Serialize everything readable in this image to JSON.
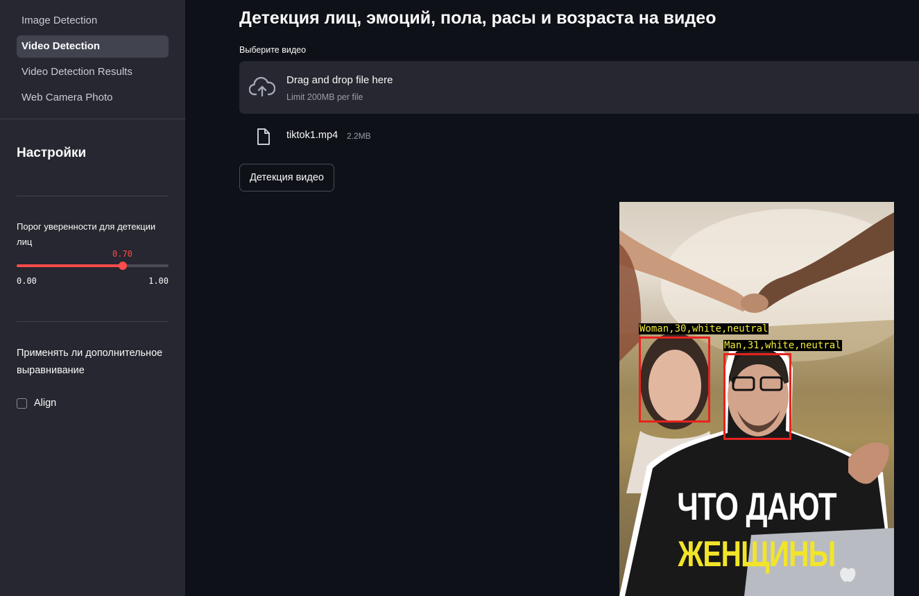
{
  "sidebar": {
    "nav": [
      {
        "label": "Image Detection",
        "active": false
      },
      {
        "label": "Video Detection",
        "active": true
      },
      {
        "label": "Video Detection Results",
        "active": false
      },
      {
        "label": "Web Camera Photo",
        "active": false
      }
    ],
    "settings_title": "Настройки",
    "confidence": {
      "label": "Порог уверенности для детекции лиц",
      "value": "0.70",
      "value_fraction": 0.7,
      "min": "0.00",
      "max": "1.00"
    },
    "align": {
      "question": "Применять ли дополнительное выравнивание",
      "checkbox_label": "Align",
      "checked": false
    }
  },
  "main": {
    "title": "Детекция лиц, эмоций, пола, расы и возраста на видео",
    "uploader": {
      "label": "Выберите видео",
      "drop_text": "Drag and drop file here",
      "limit_text": "Limit 200MB per file",
      "icon": "cloud-upload-icon"
    },
    "file": {
      "name": "tiktok1.mp4",
      "size": "2.2MB",
      "icon": "file-icon"
    },
    "detect_button": "Детекция видео"
  },
  "video": {
    "detections": [
      {
        "label": "Woman,30,white,neutral"
      },
      {
        "label": "Man,31,white,neutral"
      }
    ],
    "caption_line1": "ЧТО ДАЮТ",
    "caption_line2": "ЖЕНЩИНЫ"
  },
  "colors": {
    "accent": "#ff4b4b",
    "sidebar_bg": "#262730",
    "main_bg": "#0e1117",
    "box_red": "#e8221e",
    "label_yellow": "#f2ec3a"
  }
}
